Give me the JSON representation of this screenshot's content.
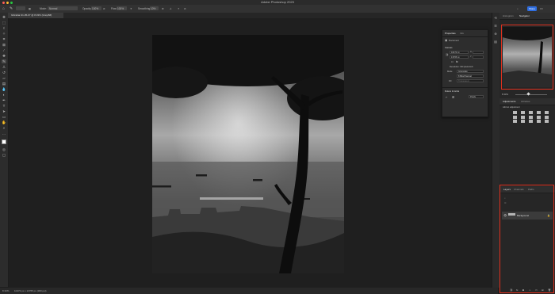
{
  "window": {
    "title": "Adobe Photoshop 2023"
  },
  "options_bar": {
    "mode_label": "Mode:",
    "mode_value": "Normal",
    "opacity_label": "Opacity:",
    "opacity_value": "100%",
    "flow_label": "Flow:",
    "flow_value": "100%",
    "smoothing_label": "Smoothing:",
    "smoothing_value": "10%",
    "share_label": "Share"
  },
  "document": {
    "tab_title": "Gibraltar-31-05-07 @ 8.33% (Gray/8#)"
  },
  "status_bar": {
    "zoom": "8.33%",
    "doc_info": "10472 px x 13765 px (300 ppi)"
  },
  "properties_panel": {
    "tabs": [
      "Properties",
      "Info"
    ],
    "doc_label": "Document",
    "canvas_section": "Canvas",
    "width": "10472 px",
    "height": "13765 px",
    "x_label": "X",
    "y_label": "Y",
    "resolution": "Resolution: 300 pixels/inch",
    "mode_label": "Mode",
    "mode_value": "Grayscale",
    "depth_value": "8 Bits/Channel",
    "fill_label": "Fill",
    "fill_value": "Transparent",
    "rulers_section": "Rulers & Grids",
    "units_value": "Pixels"
  },
  "navigator_panel": {
    "tabs": [
      "Histogram",
      "Navigator"
    ],
    "zoom": "8.33%"
  },
  "adjustments_panel": {
    "tabs": [
      "Adjustments",
      "Libraries"
    ],
    "add_label": "Add an adjustment"
  },
  "layers_panel": {
    "tabs": [
      "Layers",
      "Channels",
      "Paths"
    ],
    "layers": [
      {
        "name": "Background",
        "visible": true,
        "locked": true
      }
    ]
  },
  "colors": {
    "highlight": "#e0301e",
    "accent": "#2f6ee0"
  },
  "icons": {
    "toolbar": [
      "move-icon",
      "marquee-icon",
      "lasso-icon",
      "quick-select-icon",
      "crop-icon",
      "frame-icon",
      "eyedropper-icon",
      "healing-icon",
      "brush-icon",
      "clone-stamp-icon",
      "history-brush-icon",
      "eraser-icon",
      "gradient-icon",
      "blur-icon",
      "dodge-icon",
      "pen-icon",
      "type-icon",
      "path-select-icon",
      "rectangle-icon",
      "hand-icon",
      "zoom-icon",
      "more-icon"
    ]
  }
}
